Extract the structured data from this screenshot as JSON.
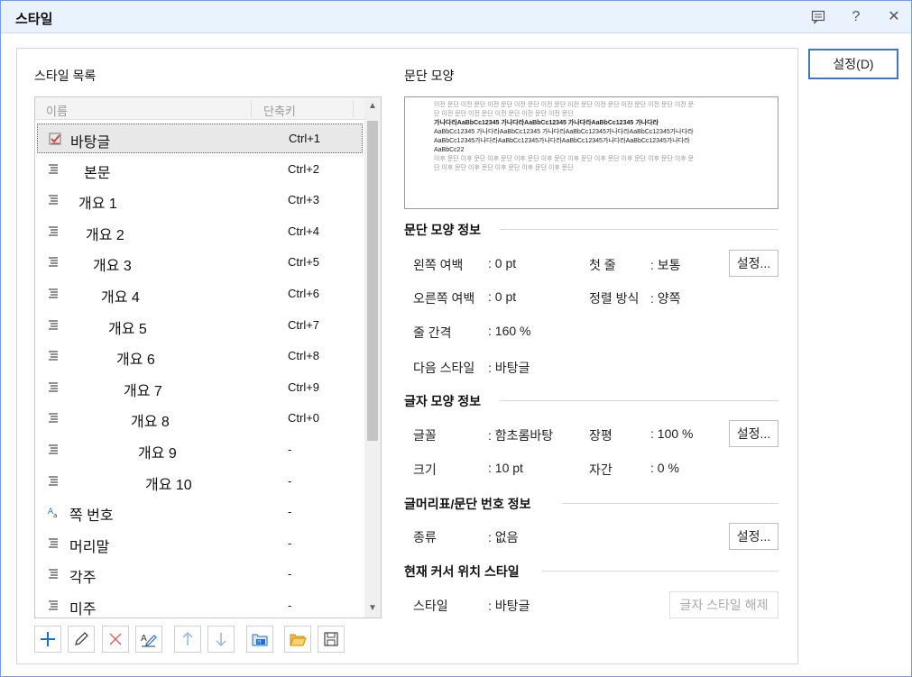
{
  "window": {
    "title": "스타일"
  },
  "titlebar": {
    "help_label": "?",
    "close_label": "✕"
  },
  "style_list": {
    "label": "스타일 목록",
    "col_name": "이름",
    "col_shortcut": "단축키",
    "items": [
      {
        "name": "바탕글",
        "shortcut": "Ctrl+1",
        "icon": "paragraph-style-check-icon"
      },
      {
        "name": "본문",
        "shortcut": "Ctrl+2",
        "icon": "paragraph-style-icon"
      },
      {
        "name": "개요 1",
        "shortcut": "Ctrl+3",
        "icon": "paragraph-style-icon"
      },
      {
        "name": "개요 2",
        "shortcut": "Ctrl+4",
        "icon": "paragraph-style-icon"
      },
      {
        "name": "개요 3",
        "shortcut": "Ctrl+5",
        "icon": "paragraph-style-icon"
      },
      {
        "name": "개요 4",
        "shortcut": "Ctrl+6",
        "icon": "paragraph-style-icon"
      },
      {
        "name": "개요 5",
        "shortcut": "Ctrl+7",
        "icon": "paragraph-style-icon"
      },
      {
        "name": "개요 6",
        "shortcut": "Ctrl+8",
        "icon": "paragraph-style-icon"
      },
      {
        "name": "개요 7",
        "shortcut": "Ctrl+9",
        "icon": "paragraph-style-icon"
      },
      {
        "name": "개요 8",
        "shortcut": "Ctrl+0",
        "icon": "paragraph-style-icon"
      },
      {
        "name": "개요 9",
        "shortcut": "-",
        "icon": "paragraph-style-icon"
      },
      {
        "name": "개요 10",
        "shortcut": "-",
        "icon": "paragraph-style-icon"
      },
      {
        "name": "쪽 번호",
        "shortcut": "-",
        "icon": "char-style-icon"
      },
      {
        "name": "머리말",
        "shortcut": "-",
        "icon": "paragraph-style-icon"
      },
      {
        "name": "각주",
        "shortcut": "-",
        "icon": "paragraph-style-icon"
      },
      {
        "name": "미주",
        "shortcut": "-",
        "icon": "paragraph-style-icon"
      }
    ]
  },
  "paragraph_preview": {
    "label": "문단 모양",
    "prev_lines": [
      "이전 문단 이전 문단 이전 문단 이전 문단 이전 문단 이전 문단 이전 문단 이전 문단 이전 문단 이전 문",
      "단 이전 문단 이전 문단 이전 문단 이전 문단 이전 문단"
    ],
    "cur_lines": [
      "가나다라AaBbCc12345        가나다라AaBbCc12345        가나다라AaBbCc12345        가나다라",
      "AaBbCc12345  가나다라AaBbCc12345  가나다라AaBbCc12345가나다라AaBbCc12345가나다라",
      "AaBbCc12345가나다라AaBbCc12345가나다라AaBbCc12345가나다라AaBbCc12345가나다라",
      "AaBbCc22"
    ],
    "next_lines": [
      "이후 문단 이후 문단 이후 문단 이후 문단 이후 문단 이후 문단 이후 문단 이후 문단 이후 문단 이후 문",
      "단 이후 문단 이후 문단 이후 문단 이후 문단 이후 문단"
    ]
  },
  "para_info": {
    "title": "문단 모양 정보",
    "left_margin_label": "왼쪽 여백",
    "left_margin_value": ": 0 pt",
    "first_line_label": "첫 줄",
    "first_line_value": ": 보통",
    "right_margin_label": "오른쪽 여백",
    "right_margin_value": ": 0 pt",
    "align_label": "정렬 방식",
    "align_value": ": 양쪽",
    "line_spacing_label": "줄 간격",
    "line_spacing_value": ": 160 %",
    "next_style_label": "다음 스타일",
    "next_style_value": ": 바탕글",
    "settings_label": "설정..."
  },
  "char_info": {
    "title": "글자 모양 정보",
    "font_label": "글꼴",
    "font_value": ": 함초롬바탕",
    "width_label": "장평",
    "width_value": ": 100 %",
    "size_label": "크기",
    "size_value": ": 10 pt",
    "spacing_label": "자간",
    "spacing_value": ": 0 %",
    "settings_label": "설정..."
  },
  "bullet_info": {
    "title": "글머리표/문단 번호 정보",
    "kind_label": "종류",
    "kind_value": ": 없음",
    "settings_label": "설정..."
  },
  "cursor_style": {
    "title": "현재 커서 위치 스타일",
    "style_label": "스타일",
    "style_value": ": 바탕글",
    "release_label": "글자 스타일 해제"
  },
  "buttons": {
    "set_label": "설정(D)"
  }
}
